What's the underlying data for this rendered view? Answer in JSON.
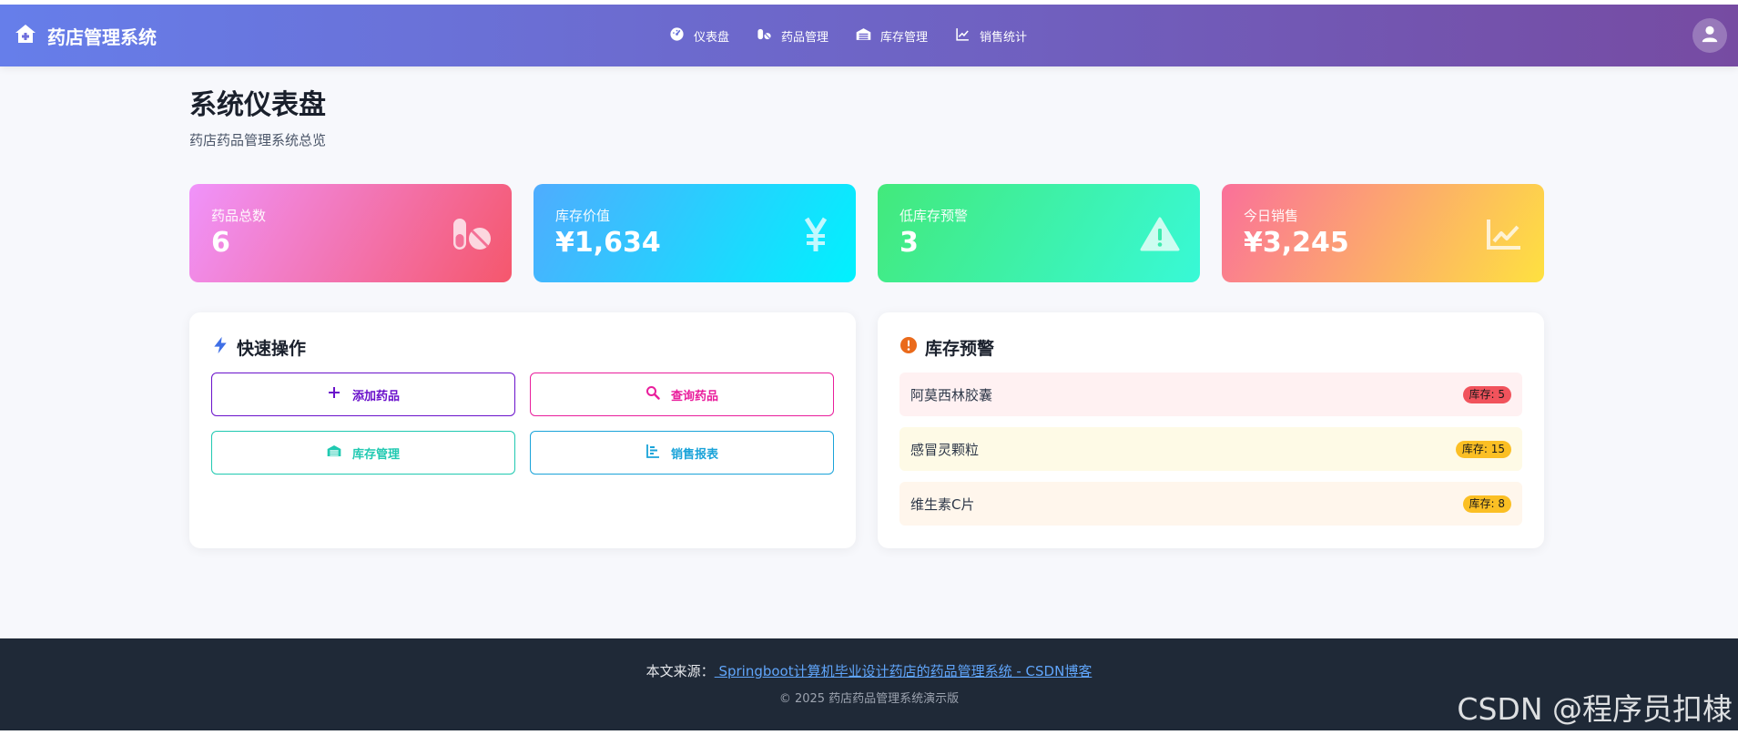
{
  "navbar": {
    "brand": "药店管理系统",
    "links": [
      {
        "label": "仪表盘",
        "icon": "tachometer-icon"
      },
      {
        "label": "药品管理",
        "icon": "pills-icon"
      },
      {
        "label": "库存管理",
        "icon": "warehouse-icon"
      },
      {
        "label": "销售统计",
        "icon": "chart-line-icon"
      }
    ]
  },
  "page": {
    "title": "系统仪表盘",
    "subtitle": "药店药品管理系统总览"
  },
  "stats": [
    {
      "label": "药品总数",
      "value": "6",
      "icon": "pills-icon"
    },
    {
      "label": "库存价值",
      "value": "¥1,634",
      "icon": "yen-icon"
    },
    {
      "label": "低库存预警",
      "value": "3",
      "icon": "warning-icon"
    },
    {
      "label": "今日销售",
      "value": "¥3,245",
      "icon": "chart-line-icon"
    }
  ],
  "quick_actions": {
    "title": "快速操作",
    "buttons": [
      {
        "label": "添加药品",
        "icon": "plus-icon",
        "color": "#6a11cb"
      },
      {
        "label": "查询药品",
        "icon": "search-icon",
        "color": "#e91e9c"
      },
      {
        "label": "库存管理",
        "icon": "warehouse-icon",
        "color": "#20c9b1"
      },
      {
        "label": "销售报表",
        "icon": "bar-chart-icon",
        "color": "#1aa3d9"
      }
    ]
  },
  "stock_alerts": {
    "title": "库存预警",
    "items": [
      {
        "name": "阿莫西林胶囊",
        "badge": "库存: 5"
      },
      {
        "name": "感冒灵颗粒",
        "badge": "库存: 15"
      },
      {
        "name": "维生素C片",
        "badge": "库存: 8"
      }
    ]
  },
  "footer": {
    "source_prefix": "本文来源：",
    "source_link": " Springboot计算机毕业设计药店的药品管理系统 - CSDN博客",
    "copyright": "© 2025 药店药品管理系统演示版"
  },
  "watermark": "CSDN @程序员扣棣",
  "colors": {
    "nav_start": "#667eea",
    "nav_end": "#764ba2",
    "alert_red": "#f1535c",
    "alert_yellow": "#fbbf24"
  }
}
